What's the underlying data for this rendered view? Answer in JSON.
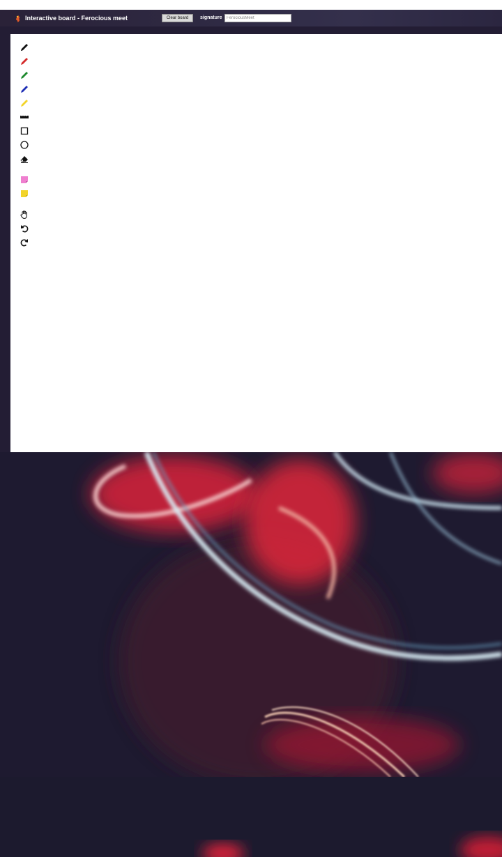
{
  "header": {
    "title": "Interactive board - Ferocious meet",
    "clear_button": "Clear board",
    "signature_label": "signature",
    "signature_value": "FerociousMeet"
  },
  "toolbar": {
    "tools": [
      {
        "name": "pencil-black-icon",
        "color": "#111111"
      },
      {
        "name": "pencil-red-icon",
        "color": "#d42a2a"
      },
      {
        "name": "pencil-green-icon",
        "color": "#1e8a2e"
      },
      {
        "name": "pencil-blue-icon",
        "color": "#1f2fb5"
      },
      {
        "name": "pencil-yellow-icon",
        "color": "#f2d42a"
      },
      {
        "name": "ruler-icon",
        "color": "#111111"
      },
      {
        "name": "rectangle-icon",
        "color": "#111111"
      },
      {
        "name": "circle-icon",
        "color": "#111111"
      },
      {
        "name": "eraser-icon",
        "color": "#111111"
      },
      {
        "name": "sticky-note-pink-icon",
        "color": "#ef7fcf"
      },
      {
        "name": "sticky-note-yellow-icon",
        "color": "#f2d42a"
      },
      {
        "name": "hand-icon",
        "color": "#111111"
      },
      {
        "name": "undo-icon",
        "color": "#111111"
      },
      {
        "name": "redo-icon",
        "color": "#111111"
      }
    ]
  },
  "colors": {
    "background": "#231d34",
    "board": "#ffffff",
    "topbar": "#2f2a44"
  }
}
